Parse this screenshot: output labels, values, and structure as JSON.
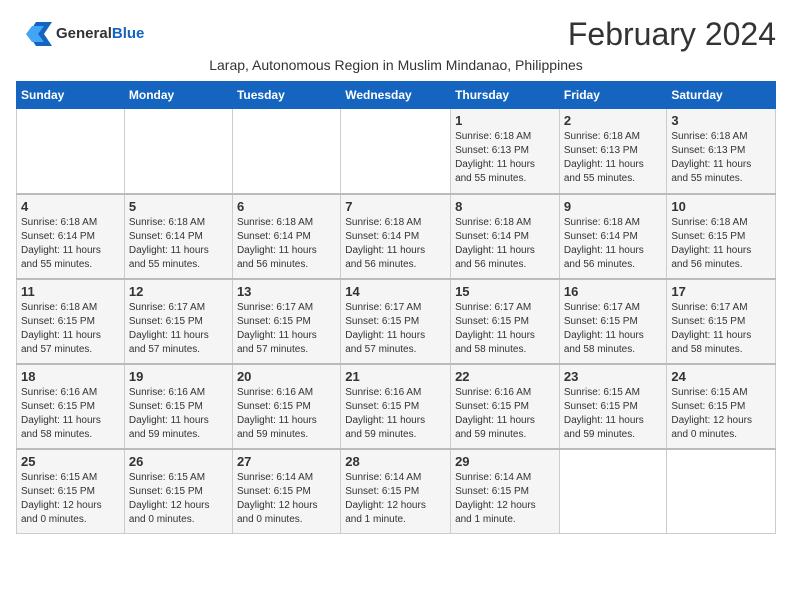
{
  "header": {
    "logo_general": "General",
    "logo_blue": "Blue",
    "month_title": "February 2024",
    "subtitle": "Larap, Autonomous Region in Muslim Mindanao, Philippines"
  },
  "weekdays": [
    "Sunday",
    "Monday",
    "Tuesday",
    "Wednesday",
    "Thursday",
    "Friday",
    "Saturday"
  ],
  "weeks": [
    [
      {
        "day": "",
        "info": ""
      },
      {
        "day": "",
        "info": ""
      },
      {
        "day": "",
        "info": ""
      },
      {
        "day": "",
        "info": ""
      },
      {
        "day": "1",
        "info": "Sunrise: 6:18 AM\nSunset: 6:13 PM\nDaylight: 11 hours\nand 55 minutes."
      },
      {
        "day": "2",
        "info": "Sunrise: 6:18 AM\nSunset: 6:13 PM\nDaylight: 11 hours\nand 55 minutes."
      },
      {
        "day": "3",
        "info": "Sunrise: 6:18 AM\nSunset: 6:13 PM\nDaylight: 11 hours\nand 55 minutes."
      }
    ],
    [
      {
        "day": "4",
        "info": "Sunrise: 6:18 AM\nSunset: 6:14 PM\nDaylight: 11 hours\nand 55 minutes."
      },
      {
        "day": "5",
        "info": "Sunrise: 6:18 AM\nSunset: 6:14 PM\nDaylight: 11 hours\nand 55 minutes."
      },
      {
        "day": "6",
        "info": "Sunrise: 6:18 AM\nSunset: 6:14 PM\nDaylight: 11 hours\nand 56 minutes."
      },
      {
        "day": "7",
        "info": "Sunrise: 6:18 AM\nSunset: 6:14 PM\nDaylight: 11 hours\nand 56 minutes."
      },
      {
        "day": "8",
        "info": "Sunrise: 6:18 AM\nSunset: 6:14 PM\nDaylight: 11 hours\nand 56 minutes."
      },
      {
        "day": "9",
        "info": "Sunrise: 6:18 AM\nSunset: 6:14 PM\nDaylight: 11 hours\nand 56 minutes."
      },
      {
        "day": "10",
        "info": "Sunrise: 6:18 AM\nSunset: 6:15 PM\nDaylight: 11 hours\nand 56 minutes."
      }
    ],
    [
      {
        "day": "11",
        "info": "Sunrise: 6:18 AM\nSunset: 6:15 PM\nDaylight: 11 hours\nand 57 minutes."
      },
      {
        "day": "12",
        "info": "Sunrise: 6:17 AM\nSunset: 6:15 PM\nDaylight: 11 hours\nand 57 minutes."
      },
      {
        "day": "13",
        "info": "Sunrise: 6:17 AM\nSunset: 6:15 PM\nDaylight: 11 hours\nand 57 minutes."
      },
      {
        "day": "14",
        "info": "Sunrise: 6:17 AM\nSunset: 6:15 PM\nDaylight: 11 hours\nand 57 minutes."
      },
      {
        "day": "15",
        "info": "Sunrise: 6:17 AM\nSunset: 6:15 PM\nDaylight: 11 hours\nand 58 minutes."
      },
      {
        "day": "16",
        "info": "Sunrise: 6:17 AM\nSunset: 6:15 PM\nDaylight: 11 hours\nand 58 minutes."
      },
      {
        "day": "17",
        "info": "Sunrise: 6:17 AM\nSunset: 6:15 PM\nDaylight: 11 hours\nand 58 minutes."
      }
    ],
    [
      {
        "day": "18",
        "info": "Sunrise: 6:16 AM\nSunset: 6:15 PM\nDaylight: 11 hours\nand 58 minutes."
      },
      {
        "day": "19",
        "info": "Sunrise: 6:16 AM\nSunset: 6:15 PM\nDaylight: 11 hours\nand 59 minutes."
      },
      {
        "day": "20",
        "info": "Sunrise: 6:16 AM\nSunset: 6:15 PM\nDaylight: 11 hours\nand 59 minutes."
      },
      {
        "day": "21",
        "info": "Sunrise: 6:16 AM\nSunset: 6:15 PM\nDaylight: 11 hours\nand 59 minutes."
      },
      {
        "day": "22",
        "info": "Sunrise: 6:16 AM\nSunset: 6:15 PM\nDaylight: 11 hours\nand 59 minutes."
      },
      {
        "day": "23",
        "info": "Sunrise: 6:15 AM\nSunset: 6:15 PM\nDaylight: 11 hours\nand 59 minutes."
      },
      {
        "day": "24",
        "info": "Sunrise: 6:15 AM\nSunset: 6:15 PM\nDaylight: 12 hours\nand 0 minutes."
      }
    ],
    [
      {
        "day": "25",
        "info": "Sunrise: 6:15 AM\nSunset: 6:15 PM\nDaylight: 12 hours\nand 0 minutes."
      },
      {
        "day": "26",
        "info": "Sunrise: 6:15 AM\nSunset: 6:15 PM\nDaylight: 12 hours\nand 0 minutes."
      },
      {
        "day": "27",
        "info": "Sunrise: 6:14 AM\nSunset: 6:15 PM\nDaylight: 12 hours\nand 0 minutes."
      },
      {
        "day": "28",
        "info": "Sunrise: 6:14 AM\nSunset: 6:15 PM\nDaylight: 12 hours\nand 1 minute."
      },
      {
        "day": "29",
        "info": "Sunrise: 6:14 AM\nSunset: 6:15 PM\nDaylight: 12 hours\nand 1 minute."
      },
      {
        "day": "",
        "info": ""
      },
      {
        "day": "",
        "info": ""
      }
    ]
  ]
}
